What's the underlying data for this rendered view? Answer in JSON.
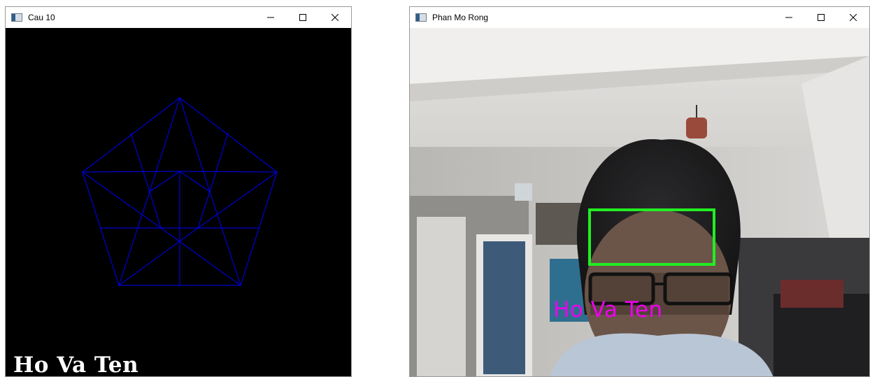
{
  "windows": [
    {
      "title": "Cau 10",
      "overlay_text": "Ho Va Ten",
      "pentagon_color": "#0000ff",
      "background": "#000000"
    },
    {
      "title": "Phan Mo Rong",
      "overlay_text": "Ho Va Ten",
      "overlay_color": "#ee00ee",
      "face_box_color": "#22ee22"
    }
  ],
  "controls": {
    "minimize_icon": "minimize-icon",
    "maximize_icon": "maximize-icon",
    "close_icon": "close-icon"
  }
}
